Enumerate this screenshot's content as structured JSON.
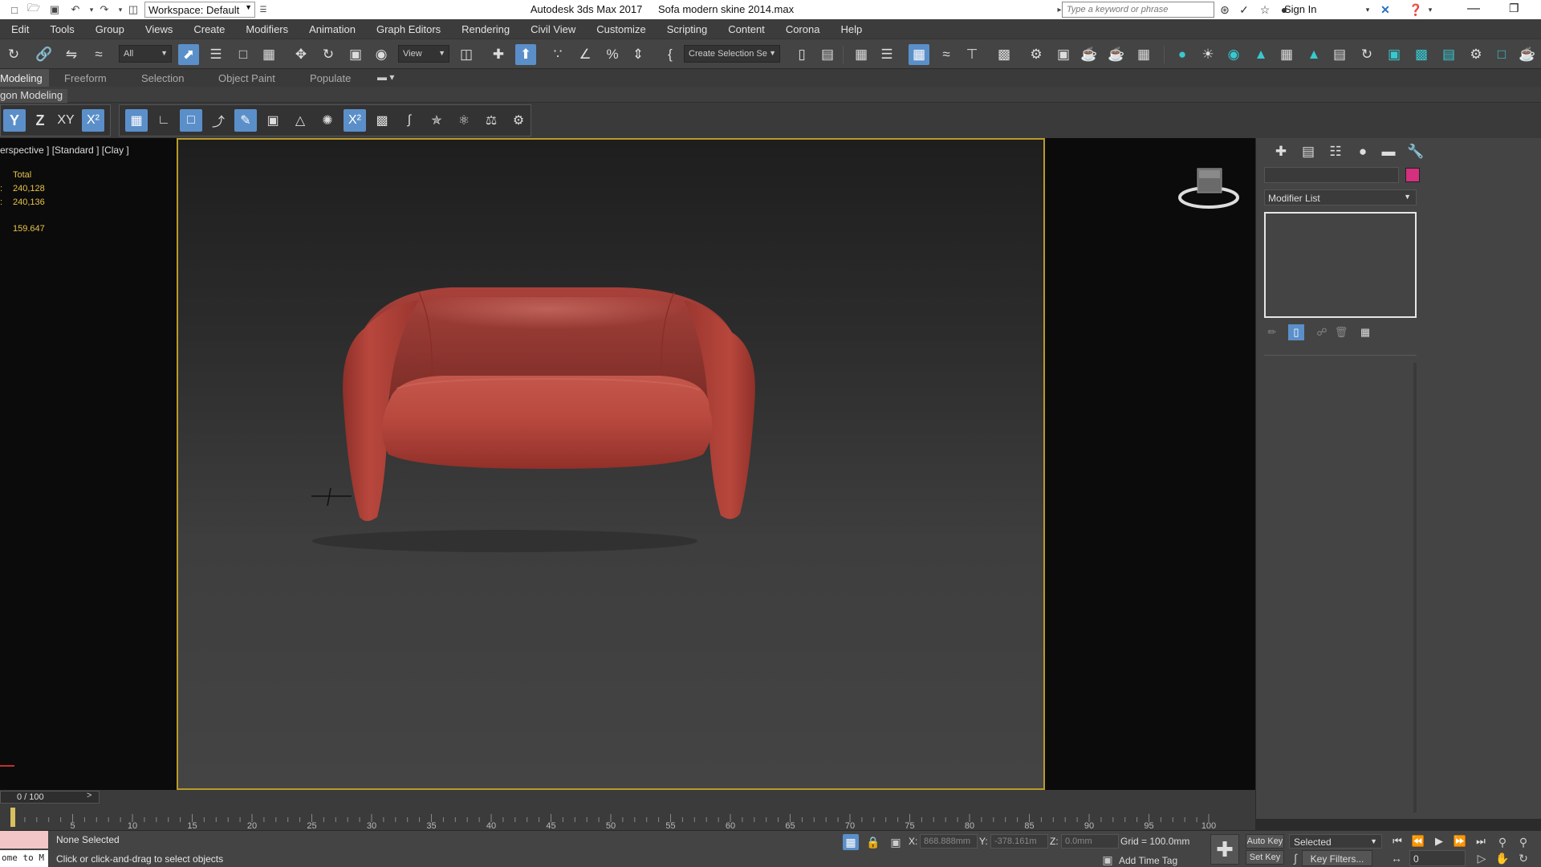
{
  "title_bar": {
    "workspace": "Workspace: Default",
    "app_name": "Autodesk 3ds Max 2017",
    "file_name": "Sofa modern skine 2014.max",
    "search_placeholder": "Type a keyword or phrase",
    "sign_in": "Sign In"
  },
  "menu": [
    "Edit",
    "Tools",
    "Group",
    "Views",
    "Create",
    "Modifiers",
    "Animation",
    "Graph Editors",
    "Rendering",
    "Civil View",
    "Customize",
    "Scripting",
    "Content",
    "Corona",
    "Help"
  ],
  "main_toolbar": {
    "selection_filter": "All",
    "ref_coord": "View",
    "named_selection": "Create Selection Se"
  },
  "ribbon": {
    "tabs": [
      "Modeling",
      "Freeform",
      "Selection",
      "Object Paint",
      "Populate"
    ],
    "active_tab": "Modeling",
    "panel_label": "gon Modeling"
  },
  "axis_constraints": {
    "y": "Y",
    "z": "Z",
    "xy": "XY",
    "xy_alt": "X²"
  },
  "viewport": {
    "label": "erspective ] [Standard ] [Clay ]",
    "stats": {
      "header": "Total",
      "polys_prefix": ":",
      "polys": "240,128",
      "verts_prefix": ":",
      "verts": "240,136",
      "fps": "159.647"
    },
    "safe_frame_color": "#b89b2a",
    "sofa_color": "#b5463b"
  },
  "command_panel": {
    "modifier_list": "Modifier List",
    "object_color": "#d4307f"
  },
  "timeline": {
    "position": "0 / 100",
    "next": ">",
    "ticks": [
      5,
      10,
      15,
      20,
      25,
      30,
      35,
      40,
      45,
      50,
      55,
      60,
      65,
      70,
      75,
      80,
      85,
      90,
      95,
      100
    ]
  },
  "status": {
    "maxscript": "ome to M",
    "selection": "None Selected",
    "prompt": "Click or click-and-drag to select objects",
    "x_label": "X:",
    "x_value": "868.888mm",
    "y_label": "Y:",
    "y_value": "-378.161m",
    "z_label": "Z:",
    "z_value": "0.0mm",
    "grid": "Grid = 100.0mm",
    "add_time_tag": "Add Time Tag",
    "auto_key": "Auto Key",
    "set_key": "Set Key",
    "key_mode": "Selected",
    "key_filters": "Key Filters...",
    "frame": "0"
  }
}
